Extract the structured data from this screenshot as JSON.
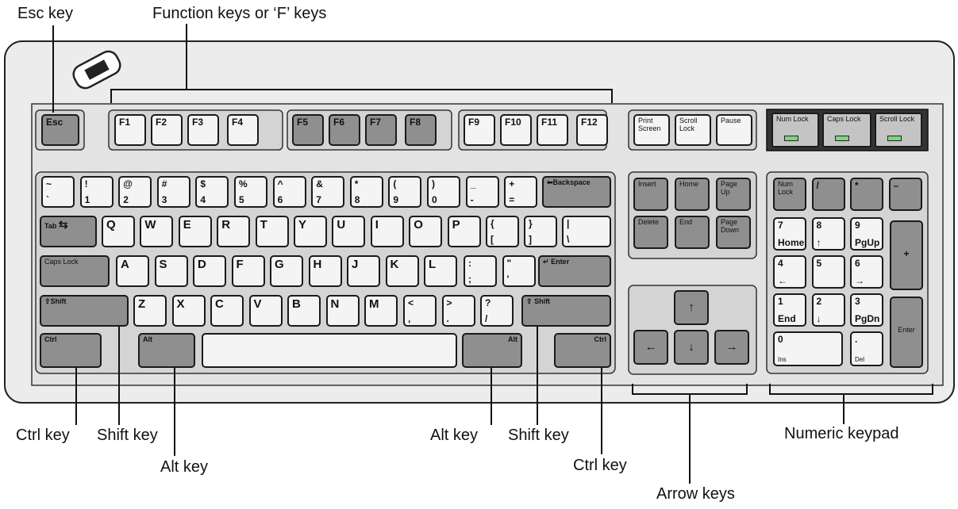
{
  "callouts": {
    "esc": "Esc key",
    "function": "Function keys or ‘F’ keys",
    "ctrl_left": "Ctrl key",
    "shift_left": "Shift key",
    "alt_left": "Alt key",
    "alt_right": "Alt key",
    "shift_right": "Shift key",
    "ctrl_right": "Ctrl key",
    "arrow": "Arrow keys",
    "numeric": "Numeric keypad"
  },
  "keys": {
    "esc": "Esc",
    "f": [
      "F1",
      "F2",
      "F3",
      "F4",
      "F5",
      "F6",
      "F7",
      "F8",
      "F9",
      "F10",
      "F11",
      "F12"
    ],
    "print_screen": "Print Screen",
    "scroll_lock": "Scroll Lock",
    "pause": "Pause",
    "indicators": [
      "Num Lock",
      "Caps Lock",
      "Scroll Lock"
    ],
    "number_row": [
      [
        "~",
        "`"
      ],
      [
        "!",
        "1"
      ],
      [
        "@",
        "2"
      ],
      [
        "#",
        "3"
      ],
      [
        "$",
        "4"
      ],
      [
        "%",
        "5"
      ],
      [
        "^",
        "6"
      ],
      [
        "&",
        "7"
      ],
      [
        "*",
        "8"
      ],
      [
        "(",
        "9"
      ],
      [
        ")",
        "0"
      ],
      [
        "_",
        "-"
      ],
      [
        "+",
        "="
      ]
    ],
    "backspace": "Backspace",
    "tab": "Tab",
    "qwerty": [
      "Q",
      "W",
      "E",
      "R",
      "T",
      "Y",
      "U",
      "I",
      "O",
      "P"
    ],
    "brackets": [
      [
        "{",
        "["
      ],
      [
        "}",
        "]"
      ],
      [
        "|",
        "\\"
      ]
    ],
    "caps_lock": "Caps Lock",
    "asdf": [
      "A",
      "S",
      "D",
      "F",
      "G",
      "H",
      "J",
      "K",
      "L"
    ],
    "punct_home": [
      [
        ":",
        ";"
      ],
      [
        "\"",
        "'"
      ]
    ],
    "enter": "Enter",
    "shift": "Shift",
    "zxcv": [
      "Z",
      "X",
      "C",
      "V",
      "B",
      "N",
      "M"
    ],
    "punct_bottom": [
      [
        "<",
        ","
      ],
      [
        ">",
        "."
      ],
      [
        "?",
        "/"
      ]
    ],
    "ctrl": "Ctrl",
    "alt": "Alt",
    "nav": [
      "Insert",
      "Home",
      "Page Up",
      "Delete",
      "End",
      "Page Down"
    ],
    "arrows": [
      "↑",
      "←",
      "↓",
      "→"
    ],
    "numpad_top": [
      "Num Lock",
      "/",
      "*",
      "–"
    ],
    "numpad_rows": [
      [
        [
          "7",
          "Home"
        ],
        [
          "8",
          "↑"
        ],
        [
          "9",
          "PgUp"
        ]
      ],
      [
        [
          "4",
          "←"
        ],
        [
          "5",
          ""
        ],
        [
          "6",
          "→"
        ]
      ],
      [
        [
          "1",
          "End"
        ],
        [
          "2",
          "↓"
        ],
        [
          "3",
          "PgDn"
        ]
      ]
    ],
    "numpad_plus": "+",
    "numpad_enter": "Enter",
    "numpad_zero": [
      "0",
      "Ins"
    ],
    "numpad_dot": [
      ".",
      "Del"
    ]
  }
}
